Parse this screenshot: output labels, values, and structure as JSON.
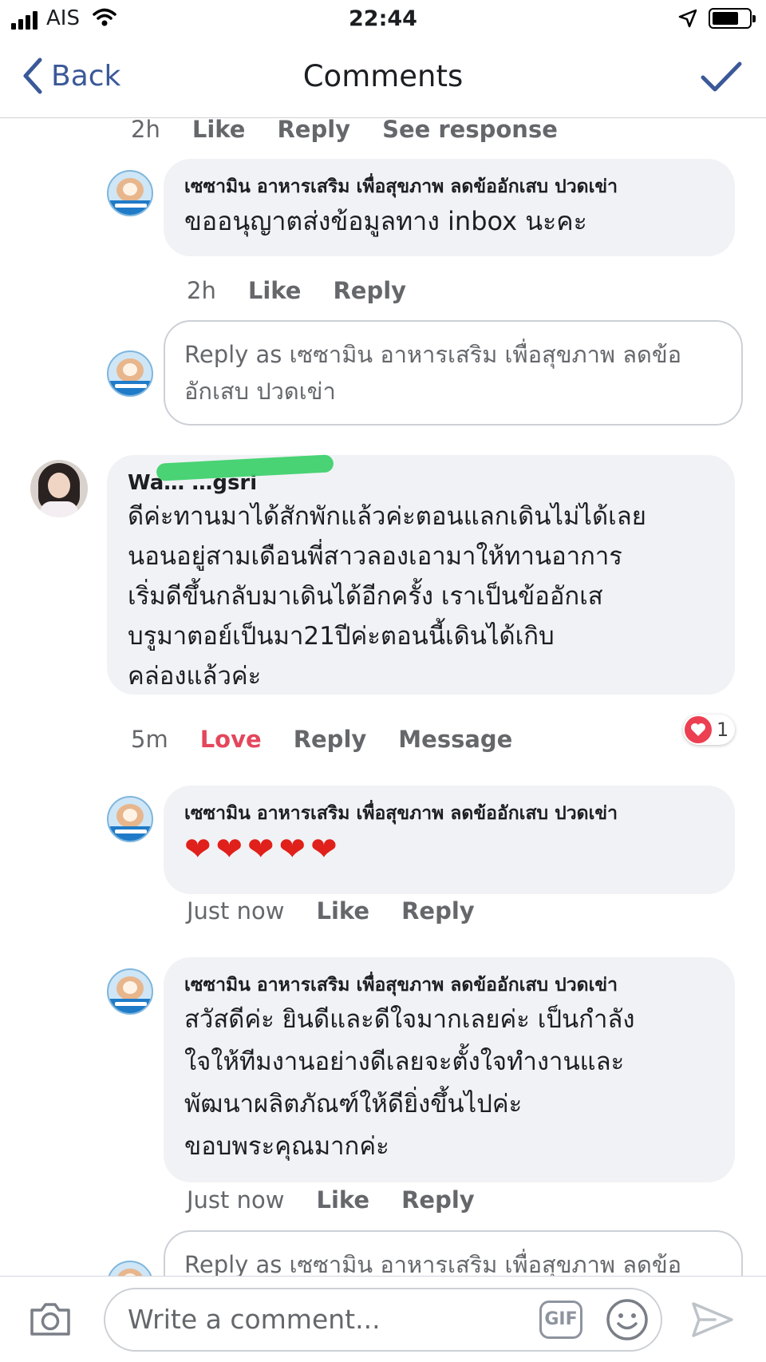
{
  "status_bar": {
    "carrier": "AIS",
    "time": "22:44"
  },
  "nav": {
    "back_label": "Back",
    "title": "Comments"
  },
  "comments": [
    {
      "meta": {
        "time": "2h",
        "like": "Like",
        "reply": "Reply",
        "see_response": "See response"
      }
    },
    {
      "author": "เซซามิน อาหารเสริม เพื่อสุขภาพ ลดข้ออักเสบ ปวดเข่า",
      "text": "ขออนุญาตส่งข้อมูลทาง inbox นะคะ",
      "meta": {
        "time": "2h",
        "like": "Like",
        "reply": "Reply"
      }
    },
    {
      "author": "Wa… …gsri",
      "text": "ดีค่ะทานมาได้สักพักแล้วค่ะตอนแลกเดินไม่ได้เลย นอนอยู่สามเดือนพี่สาวลองเอามาให้ทานอาการ เริ่มดีขึ้นกลับมาเดินได้อีกครั้ง เราเป็นข้ออักเส บรูมาตอย์เป็นมา21ปีค่ะตอนนี้เดินได้เกิบ คล่องแล้วค่ะ",
      "lines": [
        "ดีค่ะทานมาได้สักพักแล้วค่ะตอนแลกเดินไม่ได้เลย",
        "นอนอยู่สามเดือนพี่สาวลองเอามาให้ทานอาการ",
        "เริ่มดีขึ้นกลับมาเดินได้อีกครั้ง เราเป็นข้ออักเส",
        "บรูมาตอย์เป็นมา21ปีค่ะตอนนี้เดินได้เกิบ",
        "คล่องแล้วค่ะ"
      ],
      "meta": {
        "time": "5m",
        "love": "Love",
        "reply": "Reply",
        "message": "Message"
      },
      "reaction_count": "1"
    },
    {
      "author": "เซซามิน อาหารเสริม เพื่อสุขภาพ ลดข้ออักเสบ ปวดเข่า",
      "text": "❤❤❤❤❤",
      "meta": {
        "time": "Just now",
        "like": "Like",
        "reply": "Reply"
      }
    },
    {
      "author": "เซซามิน อาหารเสริม เพื่อสุขภาพ ลดข้ออักเสบ ปวดเข่า",
      "lines": [
        "สวัสดีค่ะ  ยินดีและดีใจมากเลยค่ะ เป็นกำลัง",
        "ใจให้ทีมงานอย่างดีเลยจะตั้งใจทำงานและ",
        "พัฒนาผลิตภัณฑ์ให้ดียิ่งขึ้นไปค่ะ",
        "ขอบพระคุณมากค่ะ"
      ],
      "meta": {
        "time": "Just now",
        "like": "Like",
        "reply": "Reply"
      }
    }
  ],
  "reply_box": {
    "line1": "Reply as เซซามิน อาหารเสริม เพื่อสุขภาพ ลดข้อ",
    "line2": "อักเสบ ปวดเข่า"
  },
  "composer": {
    "placeholder": "Write a comment...",
    "gif_label": "GIF"
  },
  "colors": {
    "accent": "#3b5998",
    "love": "#e4465c",
    "bubble": "#f0f2f5"
  }
}
